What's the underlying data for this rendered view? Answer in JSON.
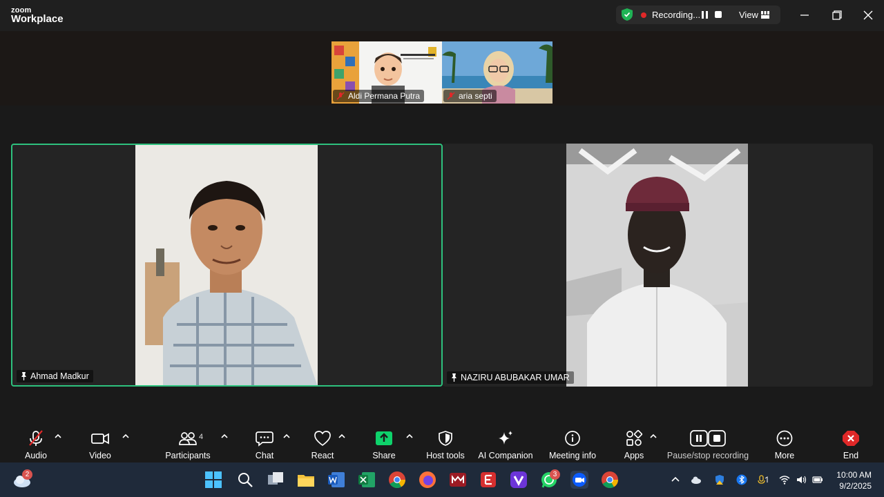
{
  "app": {
    "logo_top": "zoom",
    "logo_bottom": "Workplace"
  },
  "recording": {
    "status": "Recording...",
    "view_label": "View"
  },
  "thumbnails": [
    {
      "name": "Aldi Permana Putra"
    },
    {
      "name": "aria septi"
    }
  ],
  "tiles": [
    {
      "name": "Ahmad Madkur",
      "active": true
    },
    {
      "name": "NAZIRU ABUBAKAR UMAR",
      "active": false
    }
  ],
  "toolbar": {
    "audio": "Audio",
    "video": "Video",
    "participants": "Participants",
    "participants_count": "4",
    "chat": "Chat",
    "react": "React",
    "share": "Share",
    "host_tools": "Host tools",
    "ai_companion": "AI Companion",
    "meeting_info": "Meeting info",
    "apps": "Apps",
    "pause_stop": "Pause/stop recording",
    "more": "More",
    "end": "End"
  },
  "taskbar": {
    "weather_badge": "2",
    "whatsapp_badge": "3",
    "time": "10:00 AM",
    "date": "9/2/2025"
  },
  "colors": {
    "active_border": "#2ec27e",
    "share_green": "#0ed26b",
    "end_red": "#e02828",
    "shield_green": "#1fb355"
  }
}
